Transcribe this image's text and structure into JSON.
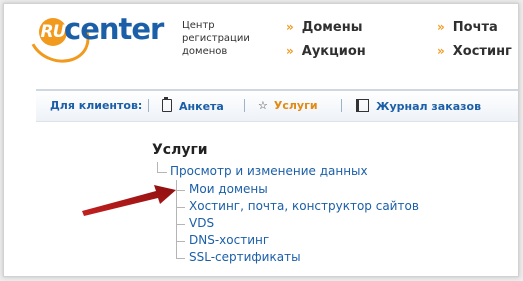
{
  "logo": {
    "ru": "RU",
    "word": "center",
    "tagline": [
      "Центр",
      "регистрации",
      "доменов"
    ]
  },
  "topnav": {
    "chevron": "»",
    "items": [
      "Домены",
      "Почта",
      "Аукцион",
      "Хостинг"
    ]
  },
  "clientbar": {
    "label": "Для клиентов:",
    "items": [
      "Анкета",
      "Услуги",
      "Журнал заказов"
    ]
  },
  "services": {
    "title": "Услуги",
    "parent": "Просмотр и изменение данных",
    "children": [
      "Мои домены",
      "Хостинг, почта, конструктор сайтов",
      "VDS",
      "DNS-хостинг",
      "SSL-сертификаты"
    ]
  },
  "colors": {
    "accent_orange": "#f29a1e",
    "brand_blue": "#1b5fa8",
    "arrow_red": "#b51a1a"
  }
}
